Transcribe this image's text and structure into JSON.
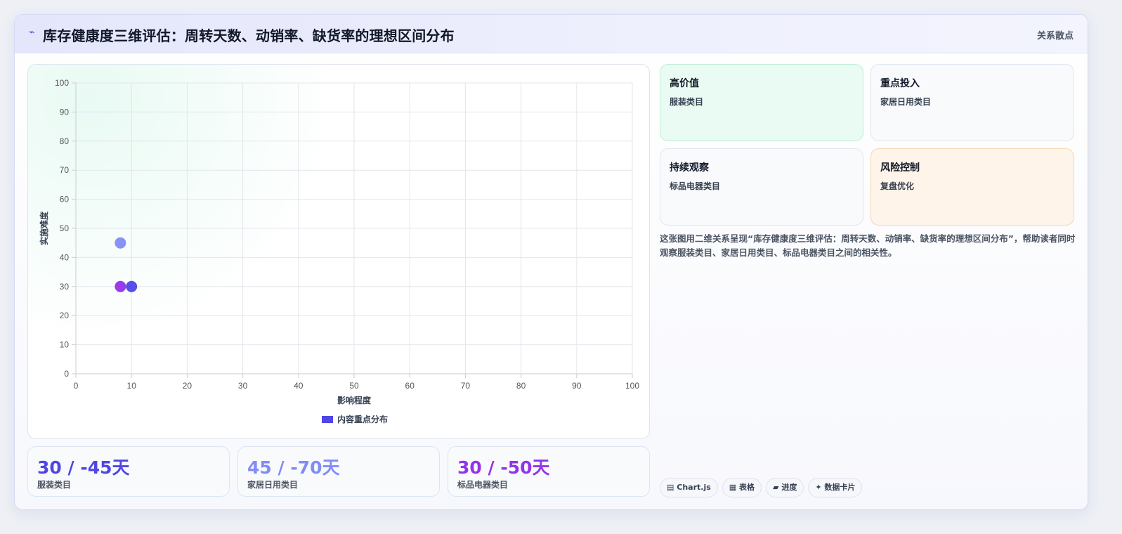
{
  "header": {
    "icon": "bolt-icon",
    "title": "库存健康度三维评估：周转天数、动销率、缺货率的理想区间分布",
    "tag": "关系散点"
  },
  "chart_data": {
    "type": "scatter",
    "xlabel": "影响程度",
    "ylabel": "实施难度",
    "xlim": [
      0,
      100
    ],
    "ylim": [
      0,
      100
    ],
    "xticks": [
      "0",
      "10",
      "20",
      "30",
      "40",
      "50",
      "60",
      "70",
      "80",
      "90",
      "100"
    ],
    "yticks": [
      "0",
      "10",
      "20",
      "30",
      "40",
      "50",
      "60",
      "70",
      "80",
      "90",
      "100"
    ],
    "grid": true,
    "legend": {
      "position": "bottom",
      "label": "内容重点分布",
      "color": "#4f46e5"
    },
    "points": [
      {
        "x": 10,
        "y": 30,
        "color": "#4f46e5"
      },
      {
        "x": 8,
        "y": 45,
        "color": "#818cf8"
      },
      {
        "x": 8,
        "y": 30,
        "color": "#9333ea"
      }
    ]
  },
  "kpis": [
    {
      "value": "30 / -45天",
      "label": "服装类目",
      "color": "#4f46e5"
    },
    {
      "value": "45 / -70天",
      "label": "家居日用类目",
      "color": "#818cf8"
    },
    {
      "value": "30 / -50天",
      "label": "标品电器类目",
      "color": "#9333ea"
    }
  ],
  "quadrants": [
    {
      "title": "高价值",
      "sub": "服装类目",
      "bg": "#eafbf3",
      "border": "#bdeed6"
    },
    {
      "title": "重点投入",
      "sub": "家居日用类目",
      "bg": "#f8fafc",
      "border": "#dfe6f1"
    },
    {
      "title": "持续观察",
      "sub": "标品电器类目",
      "bg": "#f8fafc",
      "border": "#dfe6f1"
    },
    {
      "title": "风险控制",
      "sub": "复盘优化",
      "bg": "#fff4ea",
      "border": "#f5d6b4"
    }
  ],
  "description": "这张图用二维关系呈现“库存健康度三维评估：周转天数、动销率、缺货率的理想区间分布”，帮助读者同时观察服装类目、家居日用类目、标品电器类目之间的相关性。",
  "chips": [
    {
      "icon": "chart-icon",
      "glyph": "▤",
      "label": "Chart.js"
    },
    {
      "icon": "table-icon",
      "glyph": "▦",
      "label": "表格"
    },
    {
      "icon": "progress-icon",
      "glyph": "▰",
      "label": "进度"
    },
    {
      "icon": "sparkle-icon",
      "glyph": "✦",
      "label": "数据卡片"
    }
  ]
}
